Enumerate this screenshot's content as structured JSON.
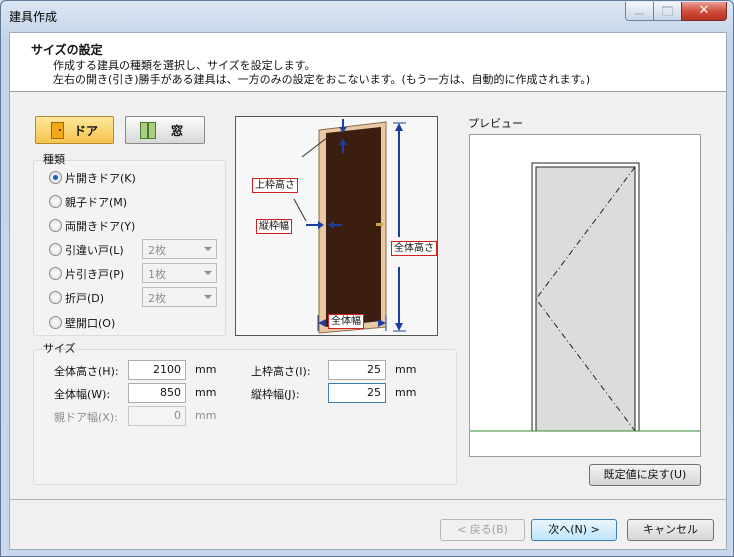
{
  "window": {
    "title": "建具作成",
    "close_glyph": "✕"
  },
  "header": {
    "title": "サイズの設定",
    "line1": "作成する建具の種類を選択し、サイズを設定します。",
    "line2": "左右の開き(引き)勝手がある建具は、一方のみの設定をおこないます。(もう一方は、自動的に作成されます。)"
  },
  "type_buttons": {
    "door": "ドア",
    "window": "窓"
  },
  "kind": {
    "caption": "種類",
    "options": [
      {
        "label": "片開きドア(K)",
        "selected": true
      },
      {
        "label": "親子ドア(M)",
        "selected": false
      },
      {
        "label": "両開きドア(Y)",
        "selected": false
      },
      {
        "label": "引違い戸(L)",
        "selected": false,
        "combo": "2枚"
      },
      {
        "label": "片引き戸(P)",
        "selected": false,
        "combo": "1枚"
      },
      {
        "label": "折戸(D)",
        "selected": false,
        "combo": "2枚"
      },
      {
        "label": "壁開口(O)",
        "selected": false
      }
    ]
  },
  "size": {
    "caption": "サイズ",
    "unit": "mm",
    "total_height_label": "全体高さ(H):",
    "total_height": "2100",
    "total_width_label": "全体幅(W):",
    "total_width": "850",
    "parent_door_width_label": "親ドア幅(X):",
    "parent_door_width": "0",
    "top_frame_height_label": "上枠高さ(I):",
    "top_frame_height": "25",
    "vertical_frame_width_label": "縦枠幅(J):",
    "vertical_frame_width": "25"
  },
  "diagram": {
    "top_frame": "上枠高さ",
    "vertical_frame": "縦枠幅",
    "total_height": "全体高さ",
    "total_width": "全体幅"
  },
  "preview": {
    "label": "プレビュー",
    "reset_button": "既定値に戻す(U)"
  },
  "footer": {
    "back": "< 戻る(B)",
    "next": "次へ(N) >",
    "cancel": "キャンセル"
  },
  "colors": {
    "door_wood": "#3b1e10",
    "door_edge": "#e9c9a3",
    "dimension": "#1c3f9e",
    "label_border": "#d22020",
    "floor": "#2f8a2f",
    "preview_door": "#dcdcdc"
  }
}
